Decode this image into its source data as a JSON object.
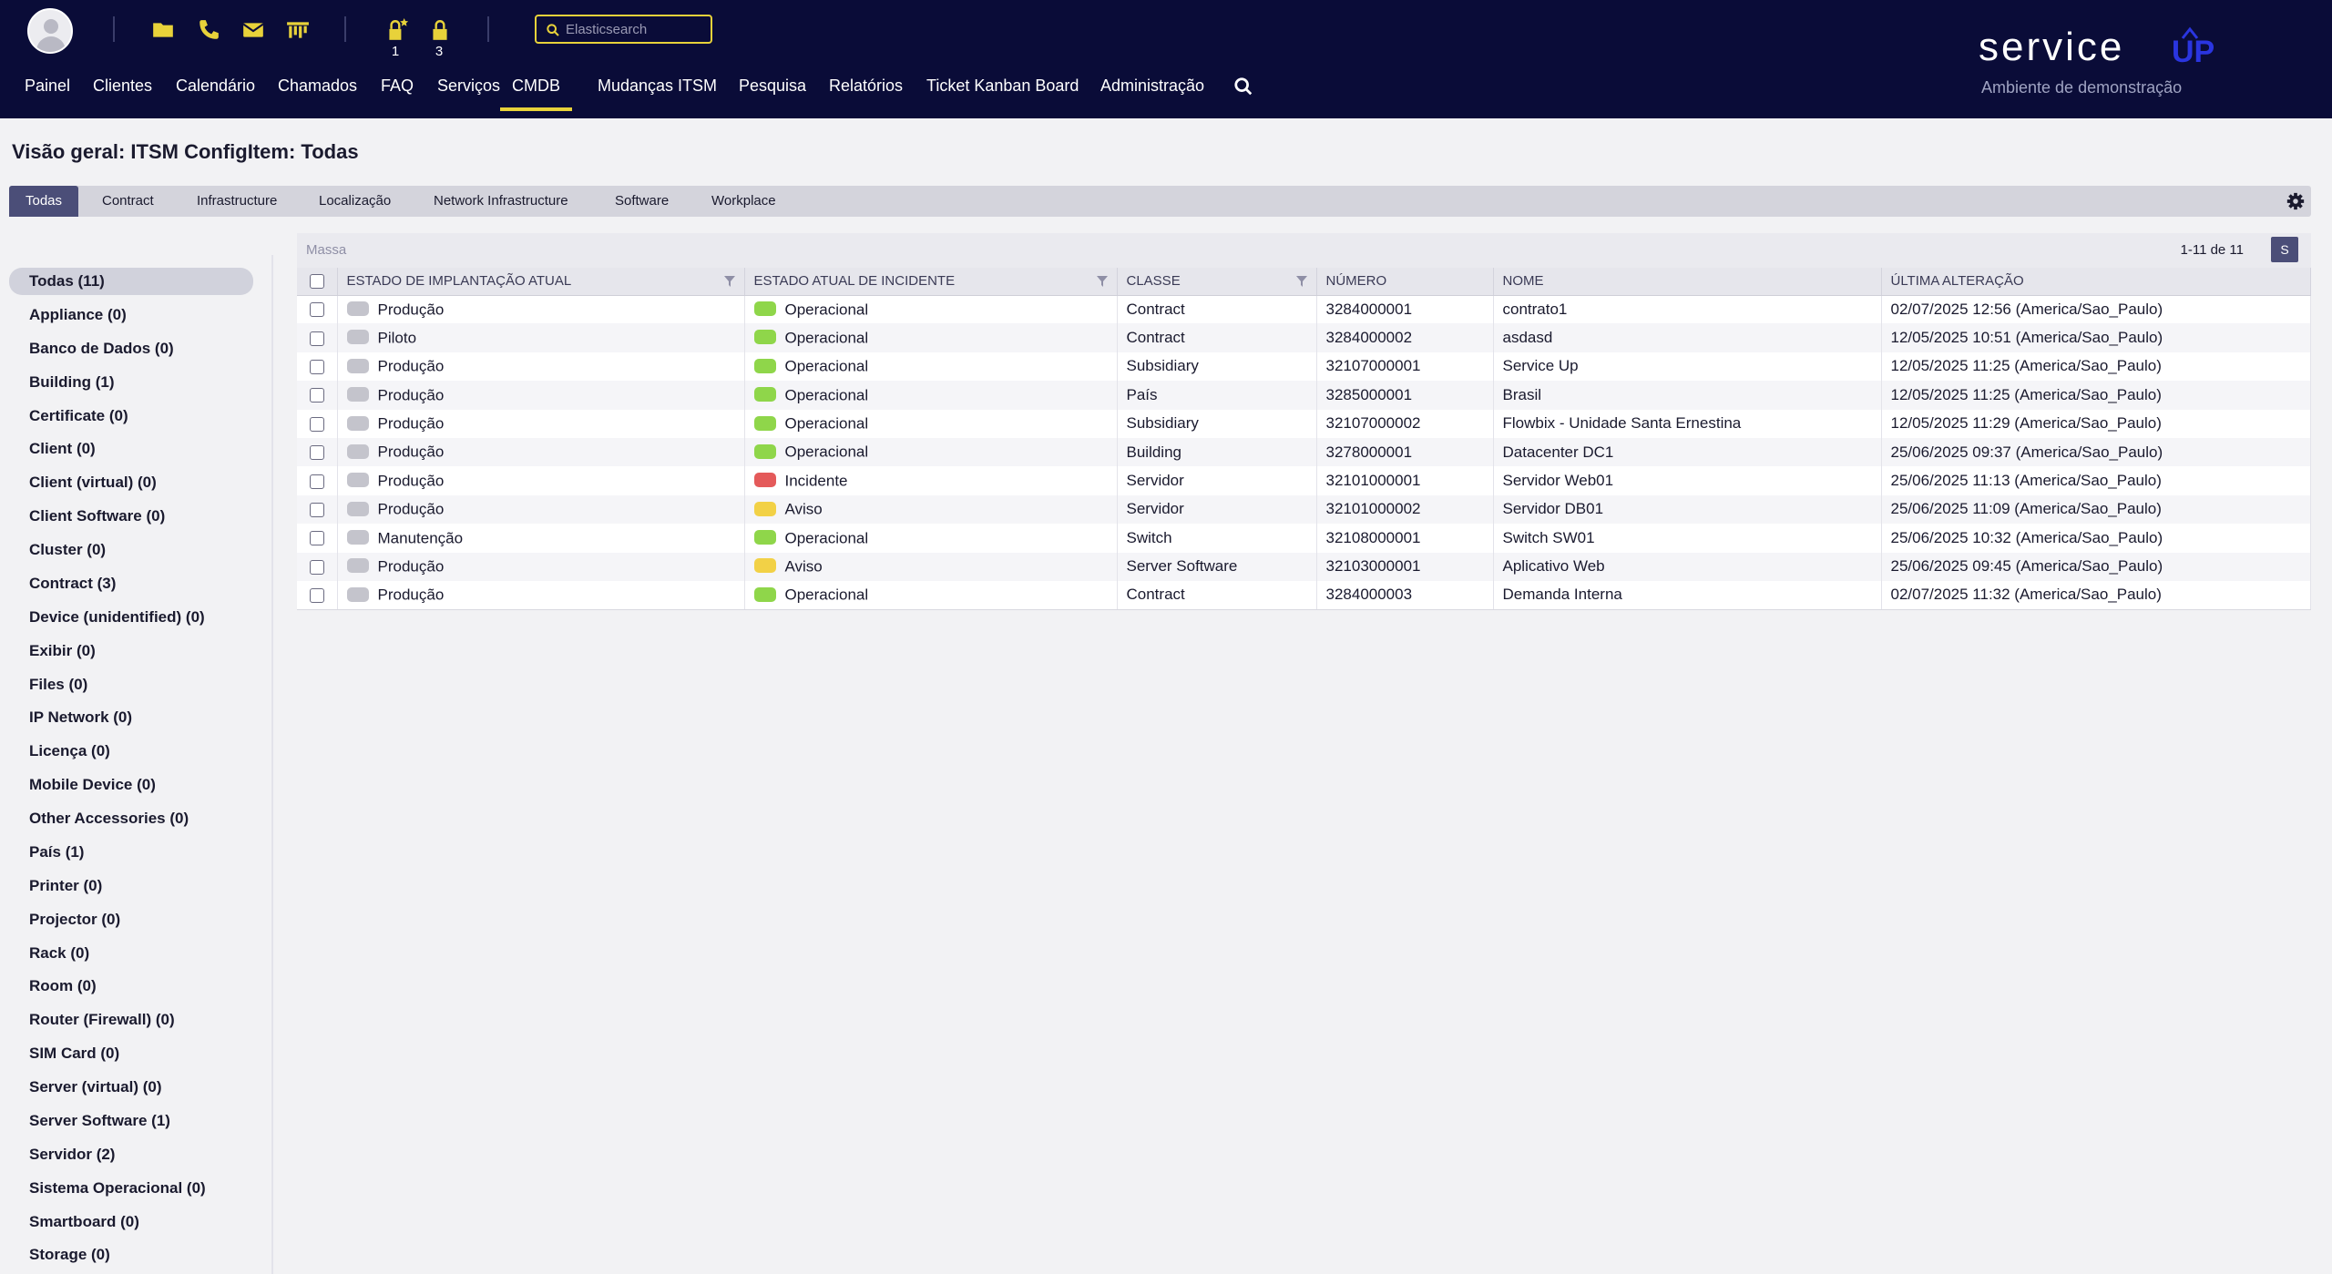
{
  "header": {
    "lock_counts": [
      "1",
      "3"
    ],
    "search_placeholder": "Elasticsearch",
    "logo_text": "service UP",
    "logo_subtitle": "Ambiente de demonstração",
    "nav": [
      {
        "label": "Painel",
        "active": false
      },
      {
        "label": "Clientes",
        "active": false
      },
      {
        "label": "Calendário",
        "active": false
      },
      {
        "label": "Chamados",
        "active": false
      },
      {
        "label": "FAQ",
        "active": false
      },
      {
        "label": "Serviços",
        "active": false
      },
      {
        "label": "CMDB",
        "active": true
      },
      {
        "label": "Mudanças ITSM",
        "active": false
      },
      {
        "label": "Pesquisa",
        "active": false
      },
      {
        "label": "Relatórios",
        "active": false
      },
      {
        "label": "Ticket Kanban Board",
        "active": false
      },
      {
        "label": "Administração",
        "active": false
      }
    ]
  },
  "page_title": "Visão geral: ITSM ConfigItem: Todas",
  "tabs": [
    "Todas",
    "Contract",
    "Infrastructure",
    "Localização",
    "Network Infrastructure",
    "Software",
    "Workplace"
  ],
  "active_tab": "Todas",
  "sidebar": [
    "Todas (11)",
    "Appliance (0)",
    "Banco de Dados (0)",
    "Building (1)",
    "Certificate (0)",
    "Client (0)",
    "Client (virtual) (0)",
    "Client Software (0)",
    "Cluster (0)",
    "Contract (3)",
    "Device (unidentified) (0)",
    "Exibir (0)",
    "Files (0)",
    "IP Network (0)",
    "Licença (0)",
    "Mobile Device (0)",
    "Other Accessories (0)",
    "País (1)",
    "Printer (0)",
    "Projector (0)",
    "Rack (0)",
    "Room (0)",
    "Router (Firewall) (0)",
    "SIM Card (0)",
    "Server (virtual) (0)",
    "Server Software (1)",
    "Servidor (2)",
    "Sistema Operacional (0)",
    "Smartboard (0)",
    "Storage (0)"
  ],
  "toolbar": {
    "bulk_label": "Massa",
    "pagination": "1-11 de 11",
    "settings_label": "S"
  },
  "table": {
    "headers": [
      "ESTADO DE IMPLANTAÇÃO ATUAL",
      "ESTADO ATUAL DE INCIDENTE",
      "CLASSE",
      "NÚMERO",
      "NOME",
      "ÚLTIMA ALTERAÇÃO"
    ],
    "rows": [
      [
        "Produção",
        "Operacional",
        "Contract",
        "3284000001",
        "contrato1",
        "02/07/2025 12:56 (America/Sao_Paulo)"
      ],
      [
        "Piloto",
        "Operacional",
        "Contract",
        "3284000002",
        "asdasd",
        "12/05/2025 10:51 (America/Sao_Paulo)"
      ],
      [
        "Produção",
        "Operacional",
        "Subsidiary",
        "32107000001",
        "Service Up",
        "12/05/2025 11:25 (America/Sao_Paulo)"
      ],
      [
        "Produção",
        "Operacional",
        "País",
        "3285000001",
        "Brasil",
        "12/05/2025 11:25 (America/Sao_Paulo)"
      ],
      [
        "Produção",
        "Operacional",
        "Subsidiary",
        "32107000002",
        "Flowbix - Unidade Santa Ernestina",
        "12/05/2025 11:29 (America/Sao_Paulo)"
      ],
      [
        "Produção",
        "Operacional",
        "Building",
        "3278000001",
        "Datacenter DC1",
        "25/06/2025 09:37 (America/Sao_Paulo)"
      ],
      [
        "Produção",
        "Incidente",
        "Servidor",
        "32101000001",
        "Servidor Web01",
        "25/06/2025 11:13 (America/Sao_Paulo)"
      ],
      [
        "Produção",
        "Aviso",
        "Servidor",
        "32101000002",
        "Servidor DB01",
        "25/06/2025 11:09 (America/Sao_Paulo)"
      ],
      [
        "Manutenção",
        "Operacional",
        "Switch",
        "32108000001",
        "Switch SW01",
        "25/06/2025 10:32 (America/Sao_Paulo)"
      ],
      [
        "Produção",
        "Aviso",
        "Server Software",
        "32103000001",
        "Aplicativo Web",
        "25/06/2025 09:45 (America/Sao_Paulo)"
      ],
      [
        "Produção",
        "Operacional",
        "Contract",
        "3284000003",
        "Demanda Interna",
        "02/07/2025 11:32 (America/Sao_Paulo)"
      ]
    ]
  },
  "colors": {
    "header_bg": "#0a0c38",
    "accent_yellow": "#e8d23a",
    "deploy_pill": "#c4c4cc",
    "operacional": "#8fd64a",
    "incidente": "#e45a5a",
    "aviso": "#f2d146",
    "tab_active": "#4b4e78"
  }
}
